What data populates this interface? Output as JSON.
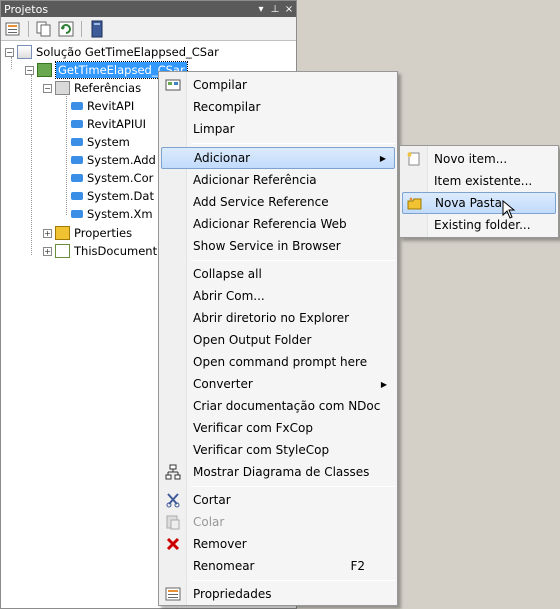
{
  "panel": {
    "title": "Projetos",
    "pin_glyph": "↓",
    "dock_glyph": "⨆",
    "close_glyph": "×"
  },
  "tree": {
    "solution": "Solução GetTimeElappsed_CSar",
    "project": "GetTimeElapsed_CSar",
    "references_label": "Referências",
    "references": [
      "RevitAPI",
      "RevitAPIUI",
      "System",
      "System.Add",
      "System.Cor",
      "System.Dat",
      "System.Xm"
    ],
    "properties": "Properties",
    "document": "ThisDocument"
  },
  "context_menu": {
    "items": [
      {
        "label": "Compilar",
        "icon": "build-icon"
      },
      {
        "label": "Recompilar"
      },
      {
        "label": "Limpar"
      },
      {
        "label": "Adicionar",
        "submenu": true
      },
      {
        "label": "Adicionar Referência"
      },
      {
        "label": "Add Service Reference"
      },
      {
        "label": "Adicionar Referencia Web"
      },
      {
        "label": "Show Service in Browser"
      },
      {
        "label": "Collapse all"
      },
      {
        "label": "Abrir Com..."
      },
      {
        "label": "Abrir diretorio no Explorer"
      },
      {
        "label": "Open Output Folder"
      },
      {
        "label": "Open command prompt here"
      },
      {
        "label": "Converter",
        "submenu": true
      },
      {
        "label": "Criar documentação com NDoc"
      },
      {
        "label": "Verificar com FxCop"
      },
      {
        "label": "Verificar com StyleCop"
      },
      {
        "label": "Mostrar Diagrama de Classes",
        "icon": "class-diagram-icon"
      },
      {
        "label": "Cortar",
        "icon": "scissors-icon"
      },
      {
        "label": "Colar",
        "icon": "paste-icon",
        "disabled": true
      },
      {
        "label": "Remover",
        "icon": "delete-icon"
      },
      {
        "label": "Renomear",
        "shortcut": "F2"
      },
      {
        "label": "Propriedades",
        "icon": "properties-icon"
      }
    ]
  },
  "submenu": {
    "items": [
      {
        "label": "Novo item...",
        "icon": "new-item-icon"
      },
      {
        "label": "Item existente..."
      },
      {
        "label": "Nova Pasta",
        "icon": "new-folder-icon"
      },
      {
        "label": "Existing folder..."
      }
    ]
  },
  "colors": {
    "highlight": "#c1dbfc",
    "selection": "#3399ff",
    "titlebar": "#5a5a5a"
  }
}
